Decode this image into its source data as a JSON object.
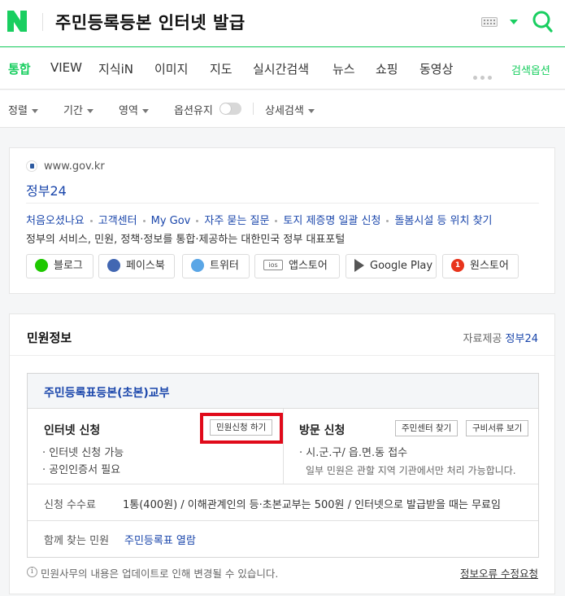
{
  "header": {
    "logo_letter": "N",
    "query": "주민등록등본 인터넷 발급",
    "brand_color": "#19ce60"
  },
  "tabs": [
    {
      "label": "통합",
      "active": true
    },
    {
      "label": "VIEW"
    },
    {
      "label": "지식iN"
    },
    {
      "label": "이미지"
    },
    {
      "label": "지도"
    },
    {
      "label": "실시간검색"
    },
    {
      "label": "뉴스"
    },
    {
      "label": "쇼핑"
    },
    {
      "label": "동영상"
    }
  ],
  "search_options_label": "검색옵션",
  "filters": {
    "sort": "정렬",
    "period": "기간",
    "area": "영역",
    "keep_options": "옵션유지",
    "detail": "상세검색"
  },
  "result": {
    "url": "www.gov.kr",
    "title": "정부24",
    "sitelinks": [
      "처음오셨나요",
      "고객센터",
      "My Gov",
      "자주 묻는 질문",
      "토지 제증명 일괄 신청",
      "돌봄시설 등 위치 찾기"
    ],
    "description": "정부의 서비스, 민원, 정책·정보를 통합·제공하는 대한민국 정부 대표포털",
    "social": [
      {
        "label": "블로그",
        "icon": "blog-icon"
      },
      {
        "label": "페이스북",
        "icon": "facebook-icon"
      },
      {
        "label": "트위터",
        "icon": "twitter-icon"
      },
      {
        "label": "앱스토어",
        "icon": "ios-icon",
        "icon_text": "ios"
      },
      {
        "label": "Google Play",
        "icon": "google-play-icon"
      },
      {
        "label": "원스토어",
        "icon": "onestore-icon",
        "icon_text": "1"
      }
    ]
  },
  "civil": {
    "title": "민원정보",
    "source_label": "자료제공",
    "source_link": "정부24",
    "doc_title": "주민등록표등본(초본)교부",
    "internet": {
      "title": "인터넷 신청",
      "button": "민원신청 하기",
      "lines": [
        "· 인터넷 신청 가능",
        "· 공인인증서 필요"
      ]
    },
    "visit": {
      "title": "방문 신청",
      "buttons": [
        "주민센터 찾기",
        "구비서류 보기"
      ],
      "line": "· 시.군.구/ 읍.면.동 접수",
      "note": "일부 민원은 관할 지역 기관에서만 처리 가능합니다."
    },
    "fee_label": "신청 수수료",
    "fee_value": "1통(400원) / 이해관계인의 등·초본교부는 500원 / 인터넷으로 발급받을 때는 무료임",
    "related_label": "함께 찾는 민원",
    "related_link": "주민등록표 열람",
    "notice_icon": "i",
    "notice": "민원사무의 내용은 업데이트로 인해 변경될 수 있습니다.",
    "report": "정보오류 수정요청",
    "highlight_color": "#e00a1a"
  }
}
